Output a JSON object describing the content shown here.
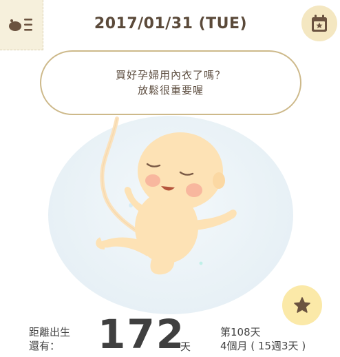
{
  "header": {
    "date": "2017/01/31 (TUE)",
    "menu_icon": "snail-menu-icon",
    "calendar_icon": "calendar-star-icon"
  },
  "bubble": {
    "line1": "買好孕婦用內衣了嗎？",
    "line2": "放鬆很重要喔"
  },
  "countdown": {
    "label_line1": "距離出生",
    "label_line2": "還有：",
    "days": "172",
    "unit": "天",
    "week_line1": "第108天",
    "week_line2": "4個月 ( 15週3天 )"
  },
  "actions": {
    "favorite_icon": "star-icon"
  },
  "colors": {
    "brand_cream": "#f6f0dc",
    "bubble_border": "#cdb98a",
    "text_brown": "#5b4a3a",
    "star_bg": "#fbe9a8",
    "star_fg": "#6b5340",
    "womb_blue": "#e8f1f6",
    "baby_skin": "#fde2b5"
  }
}
